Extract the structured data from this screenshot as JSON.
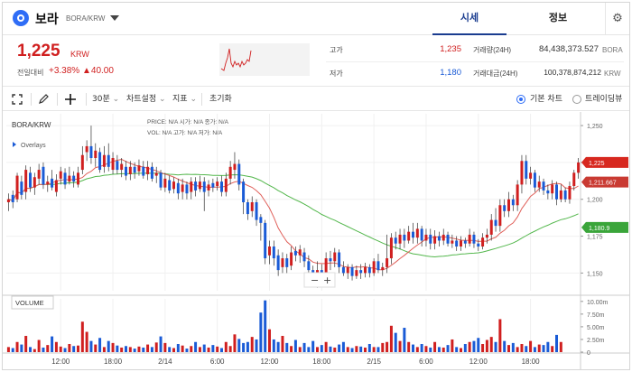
{
  "header": {
    "coin_name": "보라",
    "coin_pair": "BORA/KRW",
    "tabs": [
      {
        "label": "시세"
      },
      {
        "label": "정보"
      }
    ],
    "icons": {
      "logo": "bora-logo-icon",
      "dropdown": "chevron-down-icon",
      "settings": "gear-icon"
    }
  },
  "summary": {
    "price": "1,225",
    "unit": "KRW",
    "change_label": "전일대비",
    "change_rate": "+3.38%",
    "change_amount": "▲40.00",
    "high_label": "고가",
    "high_value": "1,235",
    "low_label": "저가",
    "low_value": "1,180",
    "volume_label": "거래량(24H)",
    "volume_value": "84,438,373.527",
    "volume_unit": "BORA",
    "amount_label": "거래대금(24H)",
    "amount_value": "100,378,874,212",
    "amount_unit": "KRW"
  },
  "toolbar": {
    "interval": "30분",
    "chart_settings": "차트설정",
    "indicators": "지표",
    "reset": "초기화",
    "view_basic": "기본 차트",
    "view_tradingview": "트레이딩뷰",
    "icons": [
      "fullscreen-icon",
      "pencil-icon",
      "crosshair-icon"
    ]
  },
  "colors": {
    "up": "#d01f1f",
    "down": "#1a5bd6",
    "ma_short": "#e0605a",
    "ma_long": "#53b74c",
    "accent": "#2f6df6"
  },
  "chart_data": {
    "type": "candlestick",
    "title": "BORA/KRW",
    "legend_price_line": "PRICE: N/A   시가: N/A   종가: N/A",
    "legend_vol_line": "VOL: N/A   고가: N/A   저가: N/A",
    "overlays_label": "Overlays",
    "volume_title": "VOLUME",
    "current_price_tag": "1,225",
    "ma_short_tag": "1,211.667",
    "ma_long_tag": "1,180.9",
    "ma_long_tag_value": 1180.9,
    "price_ylim": [
      1138,
      1258
    ],
    "price_ticks": [
      1250,
      1225,
      1200,
      1175,
      1150
    ],
    "price_tick_labels": [
      "1,250",
      "1,225",
      "1,200",
      "1,175",
      "1,150"
    ],
    "volume_ylim": [
      0,
      10.5
    ],
    "volume_ticks": [
      10,
      7.5,
      5,
      2.5,
      0
    ],
    "volume_tick_labels": [
      "10.00m",
      "7.50m",
      "5.00m",
      "2.50m",
      "0"
    ],
    "x_labels": [
      "12:00",
      "18:00",
      "2/14",
      "6:00",
      "12:00",
      "18:00",
      "2/15",
      "6:00",
      "12:00",
      "18:00"
    ],
    "x_label_positions": [
      12,
      24,
      36,
      48,
      60,
      72,
      84,
      96,
      108,
      120
    ],
    "zoom_controls": [
      "−",
      "+"
    ],
    "candles": [
      [
        1198,
        1200,
        1192,
        1204
      ],
      [
        1203,
        1198,
        1194,
        1206
      ],
      [
        1200,
        1216,
        1198,
        1218
      ],
      [
        1212,
        1203,
        1200,
        1216
      ],
      [
        1205,
        1220,
        1200,
        1223
      ],
      [
        1218,
        1208,
        1205,
        1222
      ],
      [
        1208,
        1215,
        1203,
        1218
      ],
      [
        1214,
        1220,
        1210,
        1224
      ],
      [
        1222,
        1210,
        1207,
        1225
      ],
      [
        1210,
        1212,
        1205,
        1216
      ],
      [
        1214,
        1208,
        1206,
        1220
      ],
      [
        1205,
        1213,
        1202,
        1217
      ],
      [
        1214,
        1219,
        1210,
        1222
      ],
      [
        1218,
        1210,
        1207,
        1221
      ],
      [
        1212,
        1216,
        1210,
        1222
      ],
      [
        1216,
        1212,
        1208,
        1219
      ],
      [
        1210,
        1218,
        1208,
        1222
      ],
      [
        1220,
        1230,
        1217,
        1236
      ],
      [
        1232,
        1236,
        1226,
        1240
      ],
      [
        1236,
        1228,
        1224,
        1250
      ],
      [
        1228,
        1233,
        1222,
        1238
      ],
      [
        1232,
        1220,
        1218,
        1235
      ],
      [
        1222,
        1230,
        1218,
        1236
      ],
      [
        1230,
        1222,
        1219,
        1238
      ],
      [
        1220,
        1228,
        1217,
        1232
      ],
      [
        1226,
        1220,
        1217,
        1230
      ],
      [
        1220,
        1224,
        1215,
        1228
      ],
      [
        1222,
        1216,
        1213,
        1226
      ],
      [
        1217,
        1222,
        1213,
        1226
      ],
      [
        1222,
        1218,
        1214,
        1225
      ],
      [
        1219,
        1223,
        1216,
        1227
      ],
      [
        1222,
        1216,
        1214,
        1226
      ],
      [
        1217,
        1222,
        1213,
        1226
      ],
      [
        1222,
        1214,
        1212,
        1225
      ],
      [
        1216,
        1218,
        1211,
        1222
      ],
      [
        1218,
        1208,
        1206,
        1220
      ],
      [
        1208,
        1214,
        1205,
        1218
      ],
      [
        1213,
        1206,
        1204,
        1216
      ],
      [
        1207,
        1212,
        1204,
        1215
      ],
      [
        1211,
        1204,
        1200,
        1214
      ],
      [
        1205,
        1210,
        1200,
        1214
      ],
      [
        1210,
        1204,
        1200,
        1212
      ],
      [
        1205,
        1212,
        1200,
        1215
      ],
      [
        1212,
        1206,
        1202,
        1215
      ],
      [
        1207,
        1212,
        1205,
        1216
      ],
      [
        1212,
        1205,
        1192,
        1215
      ],
      [
        1206,
        1210,
        1202,
        1213
      ],
      [
        1211,
        1208,
        1205,
        1214
      ],
      [
        1209,
        1212,
        1206,
        1215
      ],
      [
        1212,
        1205,
        1202,
        1216
      ],
      [
        1205,
        1214,
        1202,
        1218
      ],
      [
        1214,
        1222,
        1210,
        1226
      ],
      [
        1220,
        1224,
        1214,
        1232
      ],
      [
        1224,
        1210,
        1206,
        1227
      ],
      [
        1212,
        1198,
        1190,
        1214
      ],
      [
        1198,
        1190,
        1186,
        1200
      ],
      [
        1192,
        1198,
        1188,
        1202
      ],
      [
        1198,
        1186,
        1182,
        1200
      ],
      [
        1188,
        1184,
        1172,
        1190
      ],
      [
        1184,
        1160,
        1156,
        1186
      ],
      [
        1162,
        1168,
        1156,
        1172
      ],
      [
        1168,
        1160,
        1155,
        1172
      ],
      [
        1162,
        1152,
        1148,
        1166
      ],
      [
        1154,
        1160,
        1150,
        1164
      ],
      [
        1160,
        1154,
        1150,
        1163
      ],
      [
        1155,
        1164,
        1152,
        1168
      ],
      [
        1165,
        1162,
        1158,
        1168
      ],
      [
        1162,
        1166,
        1157,
        1169
      ],
      [
        1164,
        1158,
        1154,
        1167
      ],
      [
        1158,
        1152,
        1148,
        1162
      ],
      [
        1152,
        1146,
        1142,
        1155
      ],
      [
        1146,
        1152,
        1140,
        1158
      ],
      [
        1152,
        1150,
        1145,
        1156
      ],
      [
        1150,
        1160,
        1146,
        1164
      ],
      [
        1160,
        1158,
        1152,
        1165
      ],
      [
        1158,
        1164,
        1154,
        1167
      ],
      [
        1164,
        1154,
        1150,
        1166
      ],
      [
        1154,
        1150,
        1148,
        1158
      ],
      [
        1150,
        1154,
        1146,
        1156
      ],
      [
        1154,
        1148,
        1145,
        1156
      ],
      [
        1148,
        1152,
        1146,
        1155
      ],
      [
        1152,
        1150,
        1146,
        1156
      ],
      [
        1150,
        1154,
        1147,
        1157
      ],
      [
        1154,
        1150,
        1147,
        1156
      ],
      [
        1150,
        1158,
        1148,
        1160
      ],
      [
        1158,
        1152,
        1150,
        1163
      ],
      [
        1152,
        1154,
        1148,
        1157
      ],
      [
        1154,
        1160,
        1150,
        1176
      ],
      [
        1160,
        1174,
        1156,
        1177
      ],
      [
        1174,
        1170,
        1166,
        1178
      ],
      [
        1170,
        1176,
        1166,
        1180
      ],
      [
        1176,
        1172,
        1167,
        1180
      ],
      [
        1172,
        1178,
        1170,
        1182
      ],
      [
        1178,
        1174,
        1170,
        1184
      ],
      [
        1174,
        1180,
        1170,
        1184
      ],
      [
        1180,
        1172,
        1168,
        1182
      ],
      [
        1172,
        1176,
        1168,
        1180
      ],
      [
        1176,
        1170,
        1166,
        1180
      ],
      [
        1170,
        1175,
        1166,
        1179
      ],
      [
        1175,
        1172,
        1168,
        1178
      ],
      [
        1172,
        1176,
        1169,
        1180
      ],
      [
        1176,
        1170,
        1168,
        1178
      ],
      [
        1170,
        1172,
        1167,
        1176
      ],
      [
        1172,
        1168,
        1165,
        1175
      ],
      [
        1168,
        1172,
        1165,
        1175
      ],
      [
        1172,
        1170,
        1167,
        1174
      ],
      [
        1170,
        1176,
        1168,
        1180
      ],
      [
        1176,
        1170,
        1167,
        1178
      ],
      [
        1170,
        1168,
        1165,
        1173
      ],
      [
        1168,
        1174,
        1166,
        1177
      ],
      [
        1174,
        1176,
        1170,
        1180
      ],
      [
        1176,
        1186,
        1172,
        1190
      ],
      [
        1186,
        1182,
        1178,
        1194
      ],
      [
        1182,
        1196,
        1178,
        1200
      ],
      [
        1196,
        1192,
        1188,
        1200
      ],
      [
        1192,
        1200,
        1188,
        1205
      ],
      [
        1200,
        1196,
        1192,
        1203
      ],
      [
        1196,
        1210,
        1192,
        1213
      ],
      [
        1210,
        1226,
        1204,
        1230
      ],
      [
        1226,
        1214,
        1210,
        1230
      ],
      [
        1214,
        1218,
        1210,
        1222
      ],
      [
        1218,
        1208,
        1205,
        1220
      ],
      [
        1208,
        1212,
        1205,
        1216
      ],
      [
        1212,
        1206,
        1203,
        1214
      ],
      [
        1206,
        1204,
        1200,
        1210
      ],
      [
        1204,
        1210,
        1200,
        1213
      ],
      [
        1210,
        1200,
        1196,
        1212
      ],
      [
        1200,
        1206,
        1198,
        1210
      ],
      [
        1206,
        1200,
        1198,
        1208
      ],
      [
        1200,
        1209,
        1197,
        1212
      ],
      [
        1209,
        1218,
        1206,
        1220
      ],
      [
        1218,
        1225,
        1214,
        1228
      ]
    ],
    "volumes": [
      1.0,
      0.8,
      2.0,
      1.5,
      3.2,
      1.0,
      0.6,
      2.4,
      0.9,
      1.4,
      3.1,
      2.0,
      1.1,
      0.8,
      1.6,
      1.2,
      1.3,
      6.0,
      4.0,
      2.2,
      1.5,
      2.8,
      1.0,
      2.2,
      1.8,
      1.3,
      0.9,
      1.2,
      1.0,
      0.7,
      1.1,
      0.9,
      1.5,
      1.0,
      1.9,
      3.1,
      1.8,
      1.0,
      0.8,
      1.6,
      1.3,
      0.7,
      1.2,
      2.0,
      1.0,
      1.5,
      0.9,
      1.4,
      1.1,
      0.8,
      2.0,
      1.2,
      3.5,
      2.6,
      1.8,
      2.0,
      3.0,
      2.5,
      7.8,
      10.2,
      4.5,
      2.5,
      2.0,
      3.2,
      1.8,
      1.2,
      2.4,
      1.0,
      1.8,
      1.0,
      2.2,
      1.0,
      1.4,
      2.0,
      1.1,
      0.9,
      1.5,
      2.0,
      1.0,
      0.8,
      1.2,
      1.1,
      0.9,
      1.6,
      1.0,
      1.0,
      1.8,
      2.0,
      5.2,
      3.8,
      2.2,
      4.8,
      2.0,
      1.5,
      1.0,
      1.6,
      1.2,
      0.9,
      2.0,
      1.0,
      0.9,
      1.4,
      2.5,
      1.0,
      0.8,
      1.6,
      2.0,
      2.2,
      2.8,
      1.6,
      2.4,
      3.0,
      2.0,
      6.5,
      2.2,
      1.4,
      1.8,
      1.0,
      1.6,
      1.2,
      2.2,
      1.0,
      1.5,
      1.4,
      2.0,
      1.2,
      3.4,
      2.0
    ]
  }
}
